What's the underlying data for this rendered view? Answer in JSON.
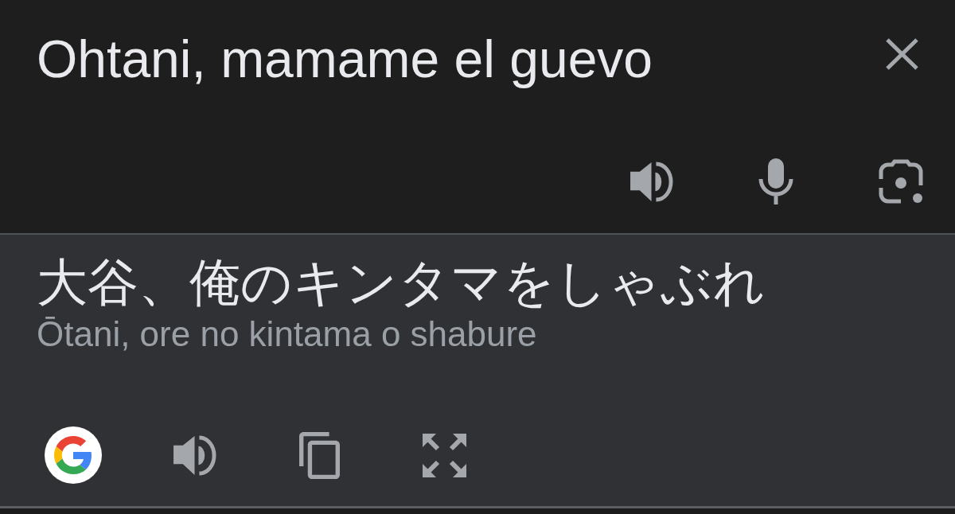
{
  "source": {
    "text": "Ohtani, mamame el guevo"
  },
  "translation": {
    "text": "大谷、俺のキンタマをしゃぶれ",
    "romanization": "Ōtani, ore no kintama o shabure"
  }
}
